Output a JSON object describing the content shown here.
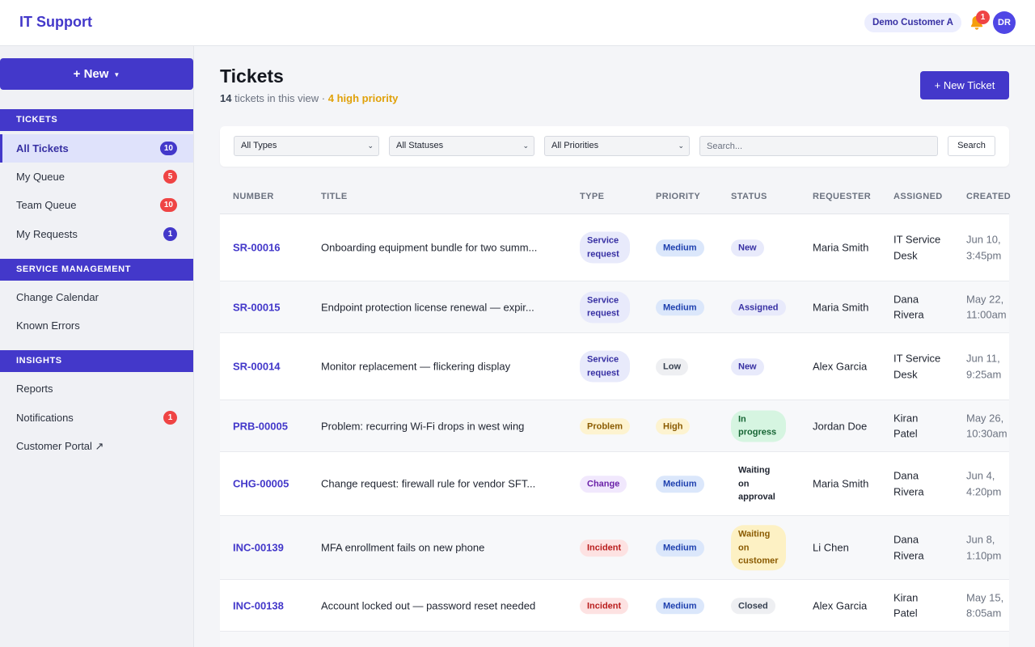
{
  "header": {
    "brand": "IT Support",
    "tenant": "Demo Customer A",
    "notification_count": "1",
    "avatar_initials": "DR"
  },
  "sidebar": {
    "new_button": "+ New",
    "sections": [
      {
        "title": "TICKETS",
        "items": [
          {
            "label": "All Tickets",
            "badge": "10",
            "active": true
          },
          {
            "label": "My Queue",
            "badge": "5"
          },
          {
            "label": "Team Queue",
            "badge": "10"
          },
          {
            "label": "My Requests",
            "badge": "1"
          }
        ]
      },
      {
        "title": "SERVICE MANAGEMENT",
        "items": [
          {
            "label": "Change Calendar"
          },
          {
            "label": "Known Errors"
          }
        ]
      },
      {
        "title": "INSIGHTS",
        "items": [
          {
            "label": "Reports"
          },
          {
            "label": "Notifications",
            "badge": "1"
          },
          {
            "label": "Customer Portal ↗"
          }
        ]
      }
    ]
  },
  "main": {
    "title": "Tickets",
    "ticket_count": "14",
    "subtitle_text": "tickets in this view",
    "separator": "·",
    "high_priority": "4 high priority",
    "new_ticket_button": "+ New Ticket",
    "filters": {
      "type": "All Types",
      "status": "All Statuses",
      "priority": "All Priorities",
      "search_placeholder": "Search...",
      "search_button": "Search"
    },
    "table": {
      "columns": [
        "NUMBER",
        "TITLE",
        "TYPE",
        "PRIORITY",
        "STATUS",
        "REQUESTER",
        "ASSIGNED",
        "CREATED"
      ],
      "rows": [
        {
          "number": "SR-00016",
          "title": "Onboarding equipment bundle for two summ...",
          "type": "Service request",
          "priority": "Medium",
          "status": "New",
          "requester": "Maria Smith",
          "assigned": "IT Service Desk",
          "created": "Jun 10, 3:45pm"
        },
        {
          "number": "SR-00015",
          "title": "Endpoint protection license renewal — expir...",
          "type": "Service request",
          "priority": "Medium",
          "status": "Assigned",
          "requester": "Maria Smith",
          "assigned": "Dana Rivera",
          "created": "May 22, 11:00am"
        },
        {
          "number": "SR-00014",
          "title": "Monitor replacement — flickering display",
          "type": "Service request",
          "priority": "Low",
          "status": "New",
          "requester": "Alex Garcia",
          "assigned": "IT Service Desk",
          "created": "Jun 11, 9:25am"
        },
        {
          "number": "PRB-00005",
          "title": "Problem: recurring Wi-Fi drops in west wing",
          "type": "Problem",
          "priority": "High",
          "status": "In progress",
          "requester": "Jordan Doe",
          "assigned": "Kiran Patel",
          "created": "May 26, 10:30am"
        },
        {
          "number": "CHG-00005",
          "title": "Change request: firewall rule for vendor SFT...",
          "type": "Change",
          "priority": "Medium",
          "status": "Waiting on approval",
          "requester": "Maria Smith",
          "assigned": "Dana Rivera",
          "created": "Jun 4, 4:20pm"
        },
        {
          "number": "INC-00139",
          "title": "MFA enrollment fails on new phone",
          "type": "Incident",
          "priority": "Medium",
          "status": "Waiting on customer",
          "requester": "Li Chen",
          "assigned": "Dana Rivera",
          "created": "Jun 8, 1:10pm"
        },
        {
          "number": "INC-00138",
          "title": "Account locked out — password reset needed",
          "type": "Incident",
          "priority": "Medium",
          "status": "Closed",
          "requester": "Alex Garcia",
          "assigned": "Kiran Patel",
          "created": "May 15, 8:05am"
        }
      ]
    }
  },
  "colors": {
    "accent": "#4338ca",
    "danger": "#ef4444",
    "warning_text": "#e0a10a"
  },
  "icons": {
    "bell": "bell-icon",
    "caret": "caret-down-icon",
    "chevron": "chevron-down-icon",
    "external": "external-link-icon"
  }
}
